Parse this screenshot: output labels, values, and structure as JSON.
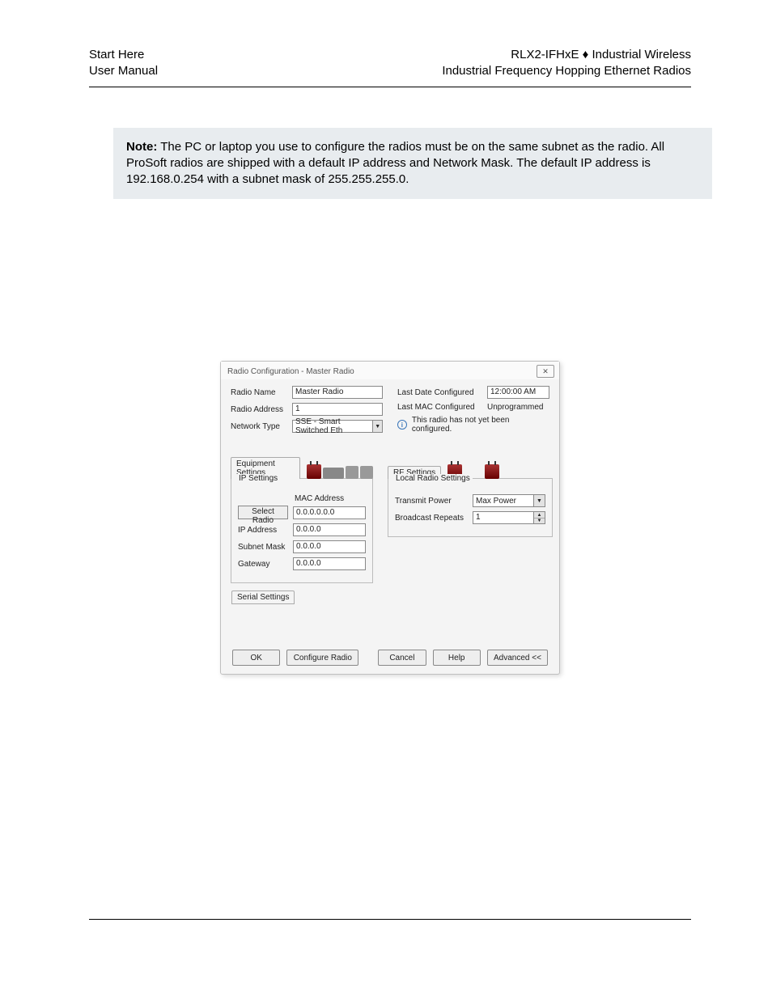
{
  "header": {
    "left_line1": "Start Here",
    "left_line2": "User Manual",
    "right_line1_a": "RLX2-IFHxE ",
    "right_line1_diamond": "♦",
    "right_line1_b": " Industrial Wireless",
    "right_line2": "Industrial Frequency Hopping Ethernet Radios"
  },
  "note": {
    "label": "Note:",
    "text": " The PC or laptop you use to configure the radios must be on the same subnet as the radio. All ProSoft radios are shipped with a default IP address and Network Mask.  The default IP address is 192.168.0.254 with a subnet mask of 255.255.255.0."
  },
  "dialog": {
    "title": "Radio Configuration - Master Radio",
    "close": "✕",
    "left": {
      "radio_name_label": "Radio Name",
      "radio_name_value": "Master Radio",
      "radio_address_label": "Radio Address",
      "radio_address_value": "1",
      "network_type_label": "Network Type",
      "network_type_value": "SSE - Smart Switched Eth"
    },
    "right": {
      "last_date_label": "Last Date Configured",
      "last_date_value": "12:00:00 AM",
      "last_mac_label": "Last MAC Configured",
      "last_mac_value": "Unprogrammed",
      "info_text": "This radio has not yet been configured."
    },
    "equipment_tab": "Equipment Settings",
    "ip_settings": {
      "legend": "IP Settings",
      "mac_label": "MAC Address",
      "select_radio_btn": "Select Radio",
      "mac_value": "0.0.0.0.0.0",
      "ip_label": "IP Address",
      "ip_value": "0.0.0.0",
      "subnet_label": "Subnet Mask",
      "subnet_value": "0.0.0.0",
      "gateway_label": "Gateway",
      "gateway_value": "0.0.0.0"
    },
    "rf_tab": "RF Settings",
    "local_radio": {
      "legend": "Local Radio Settings",
      "tx_power_label": "Transmit Power",
      "tx_power_value": "Max Power",
      "bcast_label": "Broadcast Repeats",
      "bcast_value": "1"
    },
    "serial_tab": "Serial Settings",
    "buttons": {
      "ok": "OK",
      "configure": "Configure Radio",
      "cancel": "Cancel",
      "help": "Help",
      "advanced": "Advanced <<"
    }
  }
}
